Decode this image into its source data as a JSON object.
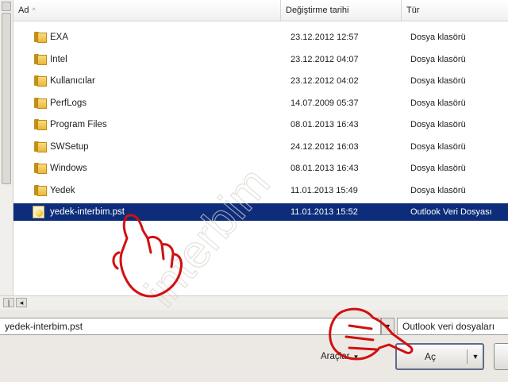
{
  "columns": {
    "name": "Ad",
    "date": "Değiştirme tarihi",
    "type": "Tür"
  },
  "files": [
    {
      "name": "EXA",
      "date": "23.12.2012 12:57",
      "type": "Dosya klasörü",
      "icon": "folder-icon",
      "selected": false
    },
    {
      "name": "Intel",
      "date": "23.12.2012 04:07",
      "type": "Dosya klasörü",
      "icon": "folder-icon",
      "selected": false
    },
    {
      "name": "Kullanıcılar",
      "date": "23.12.2012 04:02",
      "type": "Dosya klasörü",
      "icon": "folder-icon",
      "selected": false
    },
    {
      "name": "PerfLogs",
      "date": "14.07.2009 05:37",
      "type": "Dosya klasörü",
      "icon": "folder-icon",
      "selected": false
    },
    {
      "name": "Program Files",
      "date": "08.01.2013 16:43",
      "type": "Dosya klasörü",
      "icon": "folder-icon",
      "selected": false
    },
    {
      "name": "SWSetup",
      "date": "24.12.2012 16:03",
      "type": "Dosya klasörü",
      "icon": "folder-icon",
      "selected": false
    },
    {
      "name": "Windows",
      "date": "08.01.2013 16:43",
      "type": "Dosya klasörü",
      "icon": "folder-icon",
      "selected": false
    },
    {
      "name": "Yedek",
      "date": "11.01.2013 15:49",
      "type": "Dosya klasörü",
      "icon": "folder-icon",
      "selected": false
    },
    {
      "name": "yedek-interbim.pst",
      "date": "11.01.2013 15:52",
      "type": "Outlook Veri Dosyası",
      "icon": "pst-file-icon",
      "selected": true
    }
  ],
  "filename_field": {
    "value": "yedek-interbim.pst"
  },
  "filetype_select": {
    "value": "Outlook veri dosyaları"
  },
  "tools_button": {
    "label": "Araçlar"
  },
  "open_button": {
    "label": "Aç"
  },
  "watermark": "interbim",
  "colors": {
    "selection": "#0d2d7a",
    "hand_outline": "#d01010",
    "folder": "#e8b83a"
  }
}
